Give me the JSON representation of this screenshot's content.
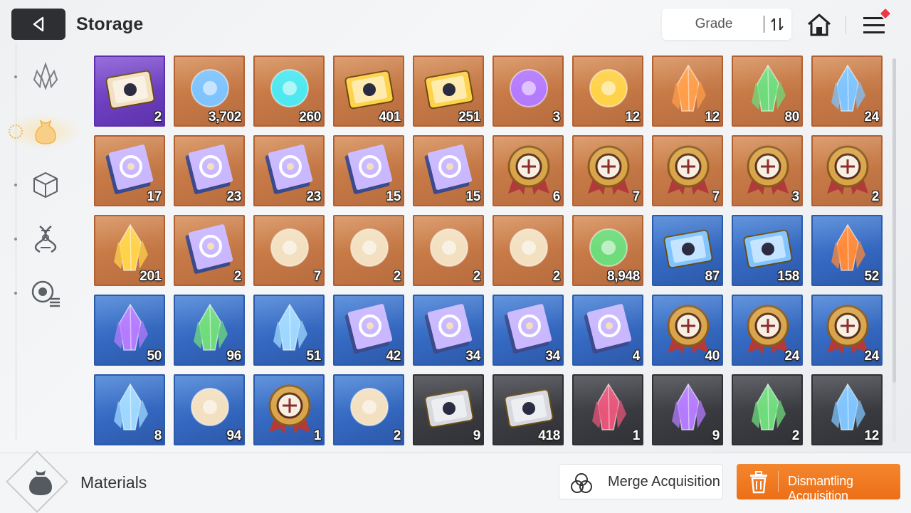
{
  "header": {
    "title": "Storage",
    "sort_label": "Grade"
  },
  "sidebar": {
    "items": [
      {
        "name": "crystal-tab",
        "active": false
      },
      {
        "name": "materials-tab",
        "active": true
      },
      {
        "name": "cube-tab",
        "active": false
      },
      {
        "name": "dna-tab",
        "active": false
      },
      {
        "name": "module-tab",
        "active": false
      }
    ]
  },
  "items": [
    {
      "icon": "card-pack-icon",
      "grade": "purple",
      "count": "2"
    },
    {
      "icon": "blue-tentacle-eye-icon",
      "grade": "orange",
      "count": "3,702"
    },
    {
      "icon": "cyan-capsule-icon",
      "grade": "orange",
      "count": "260"
    },
    {
      "icon": "gold-id-ticket-icon",
      "grade": "orange",
      "count": "401"
    },
    {
      "icon": "gold-star-ticket-icon",
      "grade": "orange",
      "count": "251"
    },
    {
      "icon": "purple-eye-creature-icon",
      "grade": "orange",
      "count": "3"
    },
    {
      "icon": "gold-feather-icon",
      "grade": "orange",
      "count": "12"
    },
    {
      "icon": "orange-crystal-icon",
      "grade": "orange",
      "count": "12"
    },
    {
      "icon": "green-crystal-icon",
      "grade": "orange",
      "count": "80"
    },
    {
      "icon": "blue-crystal-icon",
      "grade": "orange",
      "count": "24"
    },
    {
      "icon": "sword-book-icon",
      "grade": "orange",
      "count": "17"
    },
    {
      "icon": "shield-book-icon",
      "grade": "orange",
      "count": "23"
    },
    {
      "icon": "target-book-icon",
      "grade": "orange",
      "count": "23"
    },
    {
      "icon": "lightning-book-icon",
      "grade": "orange",
      "count": "15"
    },
    {
      "icon": "orb-book-icon",
      "grade": "orange",
      "count": "15"
    },
    {
      "icon": "sword-medal-icon",
      "grade": "orange",
      "count": "6"
    },
    {
      "icon": "shield-medal-icon",
      "grade": "orange",
      "count": "7"
    },
    {
      "icon": "target-medal-icon",
      "grade": "orange",
      "count": "7"
    },
    {
      "icon": "lightning-medal-icon",
      "grade": "orange",
      "count": "3"
    },
    {
      "icon": "orb-medal-icon",
      "grade": "orange",
      "count": "2"
    },
    {
      "icon": "gold-shards-icon",
      "grade": "orange",
      "count": "201"
    },
    {
      "icon": "old-map-book-icon",
      "grade": "orange",
      "count": "2"
    },
    {
      "icon": "spray-gun-icon",
      "grade": "orange",
      "count": "7"
    },
    {
      "icon": "playing-cards-icon",
      "grade": "orange",
      "count": "2"
    },
    {
      "icon": "dreamcatcher-icon",
      "grade": "orange",
      "count": "2"
    },
    {
      "icon": "guitar-pick-icon",
      "grade": "orange",
      "count": "2"
    },
    {
      "icon": "green-seed-icon",
      "grade": "orange",
      "count": "8,948"
    },
    {
      "icon": "blue-id-ticket-icon",
      "grade": "blue",
      "count": "87"
    },
    {
      "icon": "blue-star-ticket-icon",
      "grade": "blue",
      "count": "158"
    },
    {
      "icon": "fire-crystal-icon",
      "grade": "blue",
      "count": "52"
    },
    {
      "icon": "purple-crystal-icon",
      "grade": "blue",
      "count": "50"
    },
    {
      "icon": "green-crystal-icon",
      "grade": "blue",
      "count": "96"
    },
    {
      "icon": "ice-crystal-icon",
      "grade": "blue",
      "count": "51"
    },
    {
      "icon": "sword-book-icon",
      "grade": "blue",
      "count": "42"
    },
    {
      "icon": "shield-book-icon",
      "grade": "blue",
      "count": "34"
    },
    {
      "icon": "target-book-icon",
      "grade": "blue",
      "count": "34"
    },
    {
      "icon": "orb-book-icon",
      "grade": "blue",
      "count": "4"
    },
    {
      "icon": "sword-medal-icon",
      "grade": "blue",
      "count": "40"
    },
    {
      "icon": "shield-medal-icon",
      "grade": "blue",
      "count": "24"
    },
    {
      "icon": "target-medal-icon",
      "grade": "blue",
      "count": "24"
    },
    {
      "icon": "ice-shard-icon",
      "grade": "blue",
      "count": "8"
    },
    {
      "icon": "cake-icon",
      "grade": "blue",
      "count": "94"
    },
    {
      "icon": "red-star-medal-icon",
      "grade": "blue",
      "count": "1"
    },
    {
      "icon": "bandaged-tag-icon",
      "grade": "blue",
      "count": "2"
    },
    {
      "icon": "silver-id-ticket-icon",
      "grade": "gray",
      "count": "9"
    },
    {
      "icon": "silver-star-ticket-icon",
      "grade": "gray",
      "count": "418"
    },
    {
      "icon": "red-crystal-icon",
      "grade": "gray",
      "count": "1"
    },
    {
      "icon": "purple-crystal-icon",
      "grade": "gray",
      "count": "9"
    },
    {
      "icon": "green-crystal-icon",
      "grade": "gray",
      "count": "2"
    },
    {
      "icon": "blue-crystal-icon",
      "grade": "gray",
      "count": "12"
    }
  ],
  "footer": {
    "category_label": "Materials",
    "merge_label": "Merge Acquisition",
    "dismantle_label": "Dismantling Acquisition"
  },
  "colors": {
    "orange_grade": "#c77a46",
    "purple_grade": "#6d3fc0",
    "blue_grade": "#3468c0",
    "gray_grade": "#3a3c41",
    "accent": "#ec6f17"
  }
}
